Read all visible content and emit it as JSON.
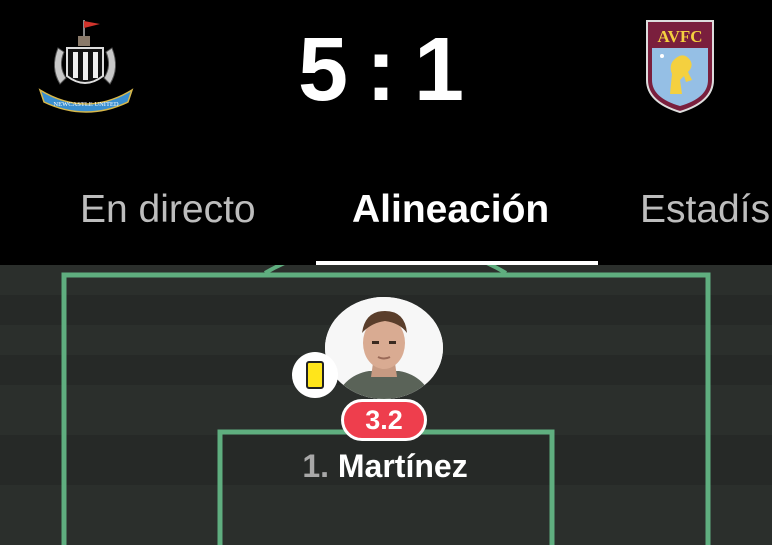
{
  "match": {
    "home_team_crest": "newcastle-united-crest",
    "home_crest_text": "NEWCASTLE UNITED",
    "away_team_crest": "aston-villa-crest",
    "away_crest_text": "AVFC",
    "home_score": "5",
    "separator": ":",
    "away_score": "1"
  },
  "tabs": [
    {
      "label": "En directo",
      "active": false
    },
    {
      "label": "Alineación",
      "active": true
    },
    {
      "label": "Estadís",
      "active": false
    }
  ],
  "player": {
    "number": "1.",
    "name": "Martínez",
    "rating": "3.2",
    "card": "yellow-card-icon"
  },
  "colors": {
    "background": "#000000",
    "pitch_dark": "#262927",
    "pitch_light": "#2b2f2c",
    "pitch_line": "#5fae7f",
    "rating_bg": "#ee3e4d",
    "yellow_card": "#ffe51b",
    "villa_claret": "#7a1f3d",
    "villa_blue": "#95bfe5"
  }
}
